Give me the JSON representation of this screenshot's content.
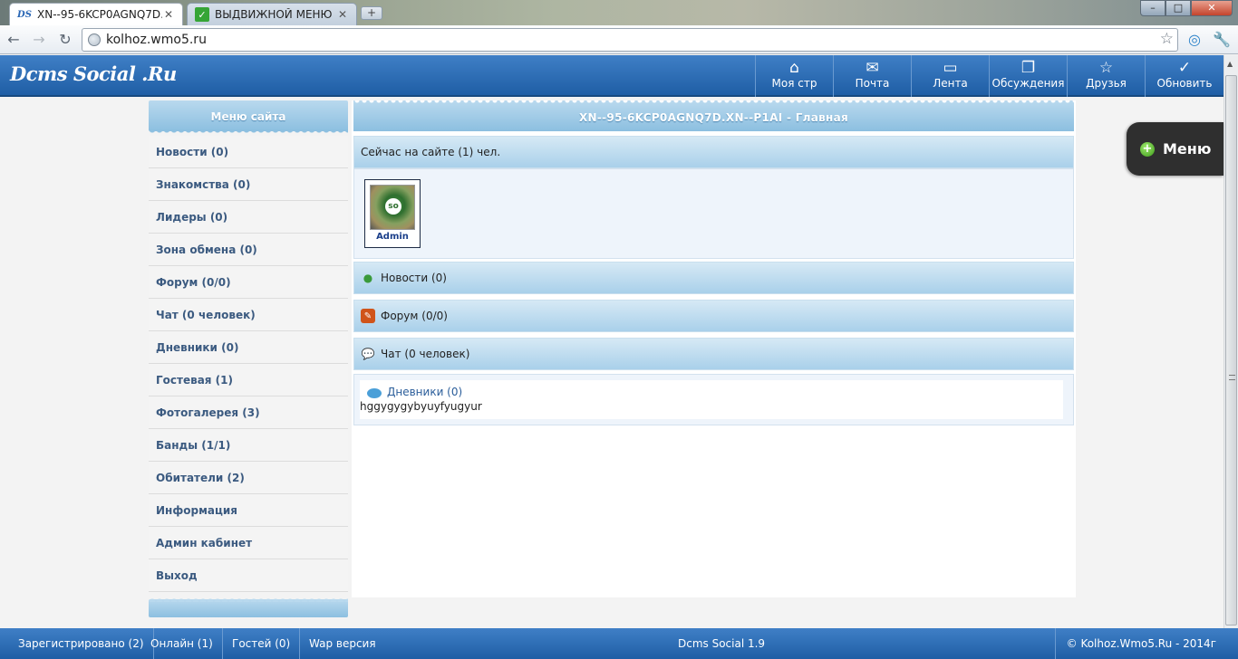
{
  "browser": {
    "tabs": [
      {
        "title": "XN--95-6KCP0AGNQ7D....",
        "active": true,
        "favicon": "DS"
      },
      {
        "title": "ВЫДВИЖНОЙ МЕНЮ",
        "active": false,
        "favicon": "checkmark-icon"
      }
    ],
    "new_tab_label": "+",
    "url": "kolhoz.wmo5.ru",
    "window_buttons": {
      "minimize": "–",
      "maximize": "□",
      "close": "✕"
    }
  },
  "site": {
    "logo": "Dcms Social .Ru",
    "nav": [
      {
        "label": "Моя стр",
        "icon": "home-icon"
      },
      {
        "label": "Почта",
        "icon": "mail-icon"
      },
      {
        "label": "Лента",
        "icon": "speech-bubble-icon"
      },
      {
        "label": "Обсуждения",
        "icon": "discussion-icon"
      },
      {
        "label": "Друзья",
        "icon": "star-icon"
      },
      {
        "label": "Обновить",
        "icon": "checkmark-icon"
      }
    ]
  },
  "sidebar": {
    "title": "Меню сайта",
    "items": [
      {
        "label": "Новости (0)"
      },
      {
        "label": "Знакомства (0)"
      },
      {
        "label": "Лидеры (0)"
      },
      {
        "label": "Зона обмена (0)"
      },
      {
        "label": "Форум (0/0)"
      },
      {
        "label": "Чат (0 человек)"
      },
      {
        "label": "Дневники (0)"
      },
      {
        "label": "Гостевая (1)"
      },
      {
        "label": "Фотогалерея (3)"
      },
      {
        "label": "Банды (1/1)"
      },
      {
        "label": "Обитатели (2)"
      },
      {
        "label": "Информация"
      },
      {
        "label": "Админ кабинет"
      },
      {
        "label": "Выход"
      }
    ]
  },
  "main": {
    "title": "XN--95-6KCP0AGNQ7D.XN--P1AI - Главная",
    "online_text": "Сейчас на сайте (1) чел.",
    "online_user": {
      "name": "Admin"
    },
    "sections": [
      {
        "label": "Новости (0)",
        "icon": "news-icon"
      },
      {
        "label": "Форум (0/0)",
        "icon": "forum-pencil-icon"
      },
      {
        "label": "Чат (0 человек)",
        "icon": "chat-icon"
      }
    ],
    "diary": {
      "title": "Дневники (0)",
      "text": "hggygygybyuyfyugyur"
    }
  },
  "float_menu": {
    "label": "Меню"
  },
  "footer": {
    "registered": "Зарегистрировано (2)",
    "online": "Онлайн (1)",
    "guests": "Гостей (0)",
    "wap": "Wap версия",
    "version": "Dcms Social 1.9",
    "copyright": "© Kolhoz.Wmo5.Ru - 2014г"
  }
}
